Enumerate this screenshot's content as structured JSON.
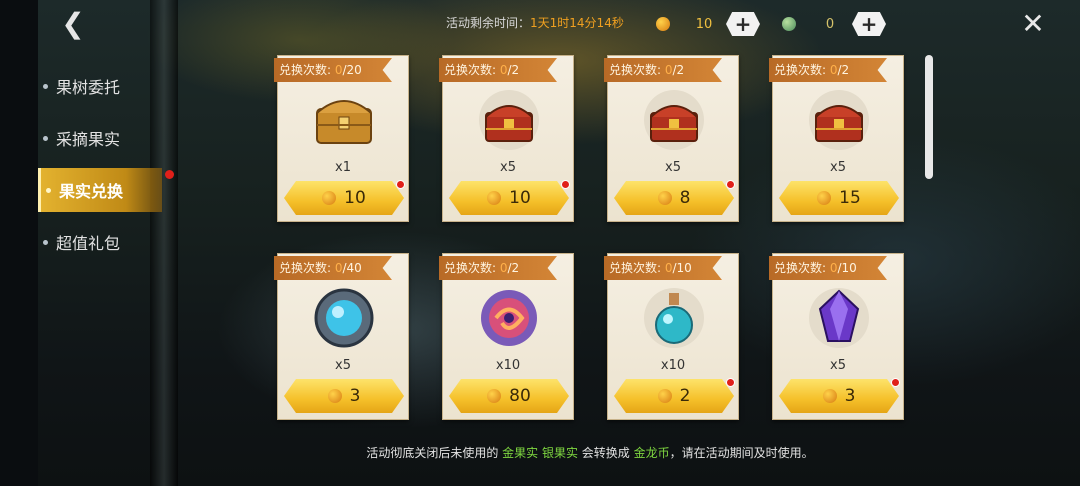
{
  "topbar": {
    "timer_label": "活动剩余时间：",
    "timer_value": "1天1时14分14秒",
    "gold_count": "10",
    "silver_count": "0",
    "plus_label": "+"
  },
  "sidebar": {
    "items": [
      {
        "label": "果树委托",
        "active": false
      },
      {
        "label": "采摘果实",
        "active": false
      },
      {
        "label": "果实兑换",
        "active": true,
        "badge": true
      },
      {
        "label": "超值礼包",
        "active": false
      }
    ]
  },
  "cards": [
    {
      "tag_prefix": "兑换次数: ",
      "used": "0",
      "limit": "/20",
      "item": "chest-gold",
      "qty": "x1",
      "price": "10",
      "red_dot": true
    },
    {
      "tag_prefix": "兑换次数: ",
      "used": "0",
      "limit": "/2",
      "item": "chest-red",
      "qty": "x5",
      "price": "10",
      "red_dot": true
    },
    {
      "tag_prefix": "兑换次数: ",
      "used": "0",
      "limit": "/2",
      "item": "chest-red",
      "qty": "x5",
      "price": "8",
      "red_dot": true
    },
    {
      "tag_prefix": "兑换次数: ",
      "used": "0",
      "limit": "/2",
      "item": "chest-red",
      "qty": "x5",
      "price": "15",
      "red_dot": false
    },
    {
      "tag_prefix": "兑换次数: ",
      "used": "0",
      "limit": "/40",
      "item": "blue-orb",
      "qty": "x5",
      "price": "3",
      "red_dot": false
    },
    {
      "tag_prefix": "兑换次数: ",
      "used": "0",
      "limit": "/2",
      "item": "swirl-orb",
      "qty": "x10",
      "price": "80",
      "red_dot": false
    },
    {
      "tag_prefix": "兑换次数: ",
      "used": "0",
      "limit": "/10",
      "item": "potion",
      "qty": "x10",
      "price": "2",
      "red_dot": true
    },
    {
      "tag_prefix": "兑换次数: ",
      "used": "0",
      "limit": "/10",
      "item": "purple-crystal",
      "qty": "x5",
      "price": "3",
      "red_dot": true
    }
  ],
  "footer": {
    "part1": "活动彻底关闭后未使用的 ",
    "highlight1": "金果实 银果实",
    "part2": " 会转换成 ",
    "highlight2": "金龙币",
    "part3": "，请在活动期间及时使用。"
  },
  "colors": {
    "accent": "#f5c02a",
    "tag": "#c97a30",
    "badge": "#e0201a",
    "highlight": "#7ed640"
  }
}
